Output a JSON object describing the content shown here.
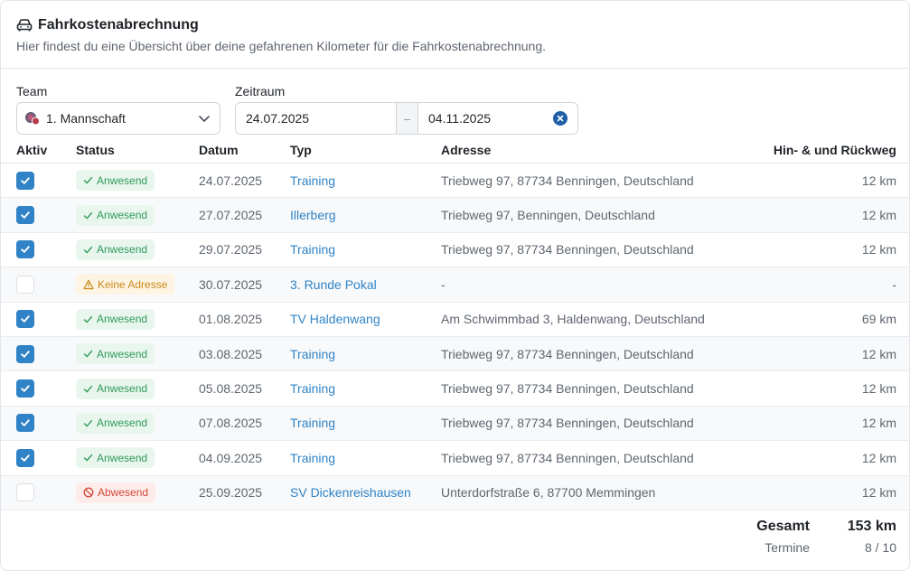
{
  "header": {
    "title": "Fahrkostenabrechnung",
    "subtitle": "Hier findest du eine Übersicht über deine gefahrenen Kilometer für die Fahrkostenabrechnung.",
    "icon": "car-icon"
  },
  "filters": {
    "team_label": "Team",
    "team_value": "1. Mannschaft",
    "period_label": "Zeitraum",
    "date_from": "24.07.2025",
    "date_sep": "–",
    "date_to": "04.11.2025"
  },
  "table": {
    "headers": {
      "aktiv": "Aktiv",
      "status": "Status",
      "datum": "Datum",
      "typ": "Typ",
      "adresse": "Adresse",
      "km": "Hin- & und Rückweg"
    },
    "rows": [
      {
        "checked": true,
        "status": "Anwesend",
        "status_kind": "present",
        "datum": "24.07.2025",
        "typ": "Training",
        "adresse": "Triebweg 97, 87734 Benningen, Deutschland",
        "km": "12 km"
      },
      {
        "checked": true,
        "status": "Anwesend",
        "status_kind": "present",
        "datum": "27.07.2025",
        "typ": "Illerberg",
        "adresse": "Triebweg 97, Benningen, Deutschland",
        "km": "12 km"
      },
      {
        "checked": true,
        "status": "Anwesend",
        "status_kind": "present",
        "datum": "29.07.2025",
        "typ": "Training",
        "adresse": "Triebweg 97, 87734 Benningen, Deutschland",
        "km": "12 km"
      },
      {
        "checked": false,
        "status": "Keine Adresse",
        "status_kind": "noaddr",
        "datum": "30.07.2025",
        "typ": "3. Runde Pokal",
        "adresse": "-",
        "km": "-"
      },
      {
        "checked": true,
        "status": "Anwesend",
        "status_kind": "present",
        "datum": "01.08.2025",
        "typ": "TV Haldenwang",
        "adresse": "Am Schwimmbad 3, Haldenwang, Deutschland",
        "km": "69 km"
      },
      {
        "checked": true,
        "status": "Anwesend",
        "status_kind": "present",
        "datum": "03.08.2025",
        "typ": "Training",
        "adresse": "Triebweg 97, 87734 Benningen, Deutschland",
        "km": "12 km"
      },
      {
        "checked": true,
        "status": "Anwesend",
        "status_kind": "present",
        "datum": "05.08.2025",
        "typ": "Training",
        "adresse": "Triebweg 97, 87734 Benningen, Deutschland",
        "km": "12 km"
      },
      {
        "checked": true,
        "status": "Anwesend",
        "status_kind": "present",
        "datum": "07.08.2025",
        "typ": "Training",
        "adresse": "Triebweg 97, 87734 Benningen, Deutschland",
        "km": "12 km"
      },
      {
        "checked": true,
        "status": "Anwesend",
        "status_kind": "present",
        "datum": "04.09.2025",
        "typ": "Training",
        "adresse": "Triebweg 97, 87734 Benningen, Deutschland",
        "km": "12 km"
      },
      {
        "checked": false,
        "status": "Abwesend",
        "status_kind": "absent",
        "datum": "25.09.2025",
        "typ": "SV Dickenreishausen",
        "adresse": "Unterdorfstraße 6, 87700 Memmingen",
        "km": "12 km"
      }
    ]
  },
  "footer": {
    "total_label": "Gesamt",
    "total_value": "153 km",
    "count_label": "Termine",
    "count_value": "8 / 10"
  },
  "colors": {
    "accent": "#2f83c6",
    "present": "#2f9a5a",
    "noaddr": "#c98a1a",
    "absent": "#d24a3c"
  }
}
